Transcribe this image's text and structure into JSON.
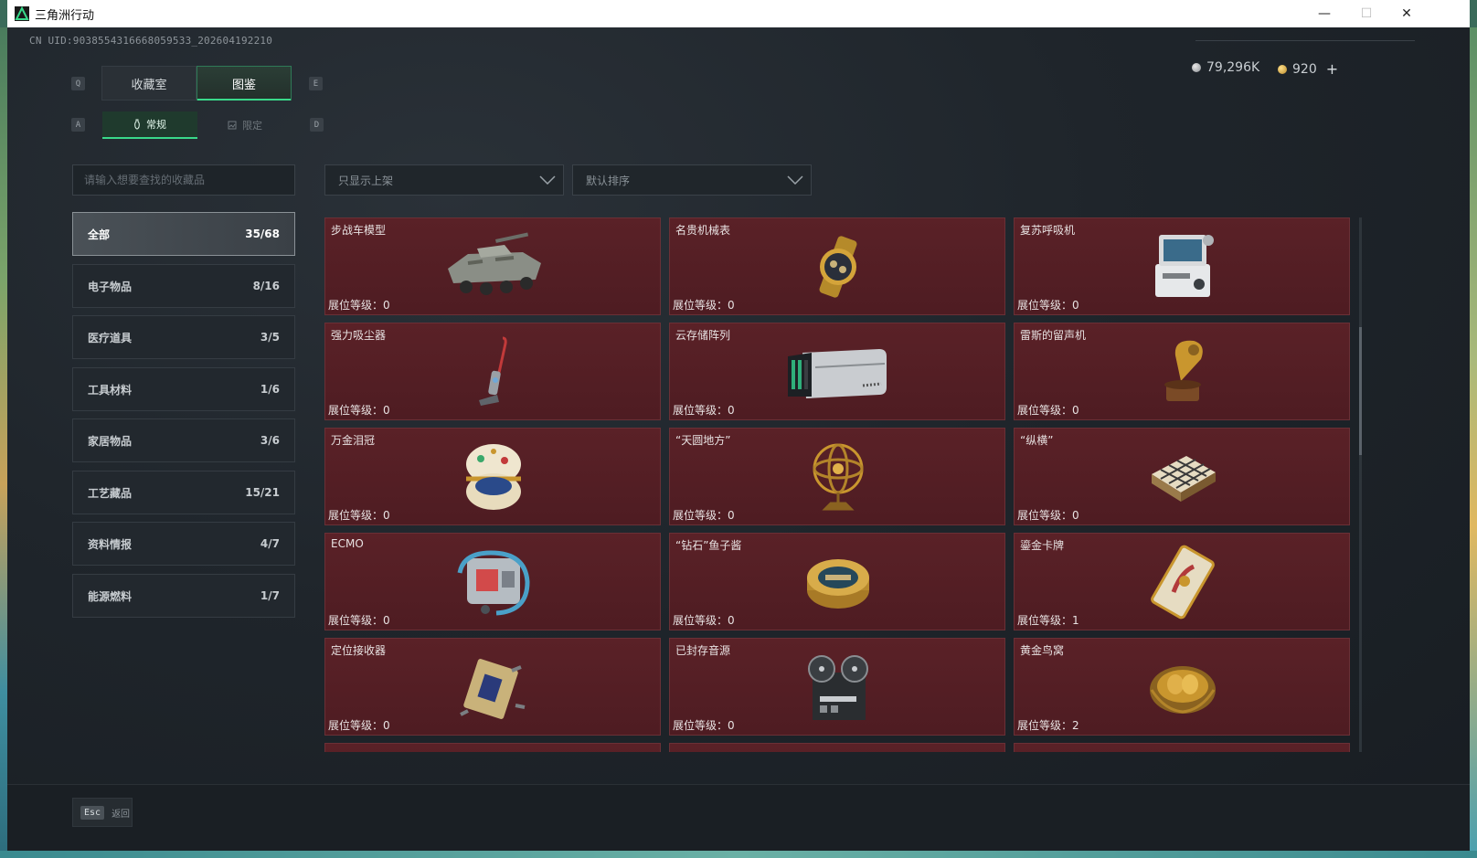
{
  "window": {
    "title": "三角洲行动",
    "min_label": "—",
    "max_label": "☐",
    "close_label": "✕"
  },
  "header": {
    "uid": "CN UID:9038554316668059533_202604192210",
    "currency_silver": "79,296K",
    "currency_gold": "920",
    "add_label": "+"
  },
  "keys": {
    "q": "Q",
    "e": "E",
    "a": "A",
    "d": "D"
  },
  "tabs": [
    {
      "label": "收藏室"
    },
    {
      "label": "图鉴"
    }
  ],
  "subtabs": [
    {
      "label": "常规"
    },
    {
      "label": "限定"
    }
  ],
  "search": {
    "placeholder": "请输入想要查找的收藏品"
  },
  "filters": {
    "display": "只显示上架",
    "sort": "默认排序"
  },
  "categories": [
    {
      "name": "全部",
      "count": "35/68"
    },
    {
      "name": "电子物品",
      "count": "8/16"
    },
    {
      "name": "医疗道具",
      "count": "3/5"
    },
    {
      "name": "工具材料",
      "count": "1/6"
    },
    {
      "name": "家居物品",
      "count": "3/6"
    },
    {
      "name": "工艺藏品",
      "count": "15/21"
    },
    {
      "name": "资料情报",
      "count": "4/7"
    },
    {
      "name": "能源燃料",
      "count": "1/7"
    }
  ],
  "level_label": "展位等级：",
  "items": [
    {
      "name": "步战车模型",
      "level": "0",
      "icon": "armored-vehicle-model-icon"
    },
    {
      "name": "名贵机械表",
      "level": "0",
      "icon": "luxury-watch-icon"
    },
    {
      "name": "复苏呼吸机",
      "level": "0",
      "icon": "ventilator-icon"
    },
    {
      "name": "强力吸尘器",
      "level": "0",
      "icon": "vacuum-cleaner-icon"
    },
    {
      "name": "云存储阵列",
      "level": "0",
      "icon": "storage-array-icon"
    },
    {
      "name": "雷斯的留声机",
      "level": "0",
      "icon": "gramophone-icon"
    },
    {
      "name": "万金泪冠",
      "level": "0",
      "icon": "jeweled-egg-icon"
    },
    {
      "name": "“天圆地方”",
      "level": "0",
      "icon": "armillary-sphere-icon"
    },
    {
      "name": "“纵横”",
      "level": "0",
      "icon": "chess-board-icon"
    },
    {
      "name": "ECMO",
      "level": "0",
      "icon": "ecmo-machine-icon"
    },
    {
      "name": "“钻石”鱼子酱",
      "level": "0",
      "icon": "caviar-tin-icon"
    },
    {
      "name": "鎏金卡牌",
      "level": "1",
      "icon": "gilded-card-icon"
    },
    {
      "name": "定位接收器",
      "level": "0",
      "icon": "gps-receiver-icon"
    },
    {
      "name": "已封存音源",
      "level": "0",
      "icon": "reel-tape-recorder-icon"
    },
    {
      "name": "黄金鸟窝",
      "level": "2",
      "icon": "golden-nest-icon"
    }
  ],
  "footer": {
    "esc_key": "Esc",
    "back_label": "返回"
  },
  "colors": {
    "accent": "#39d98a",
    "card_bg": "#521e24",
    "card_border": "#6a3036"
  }
}
